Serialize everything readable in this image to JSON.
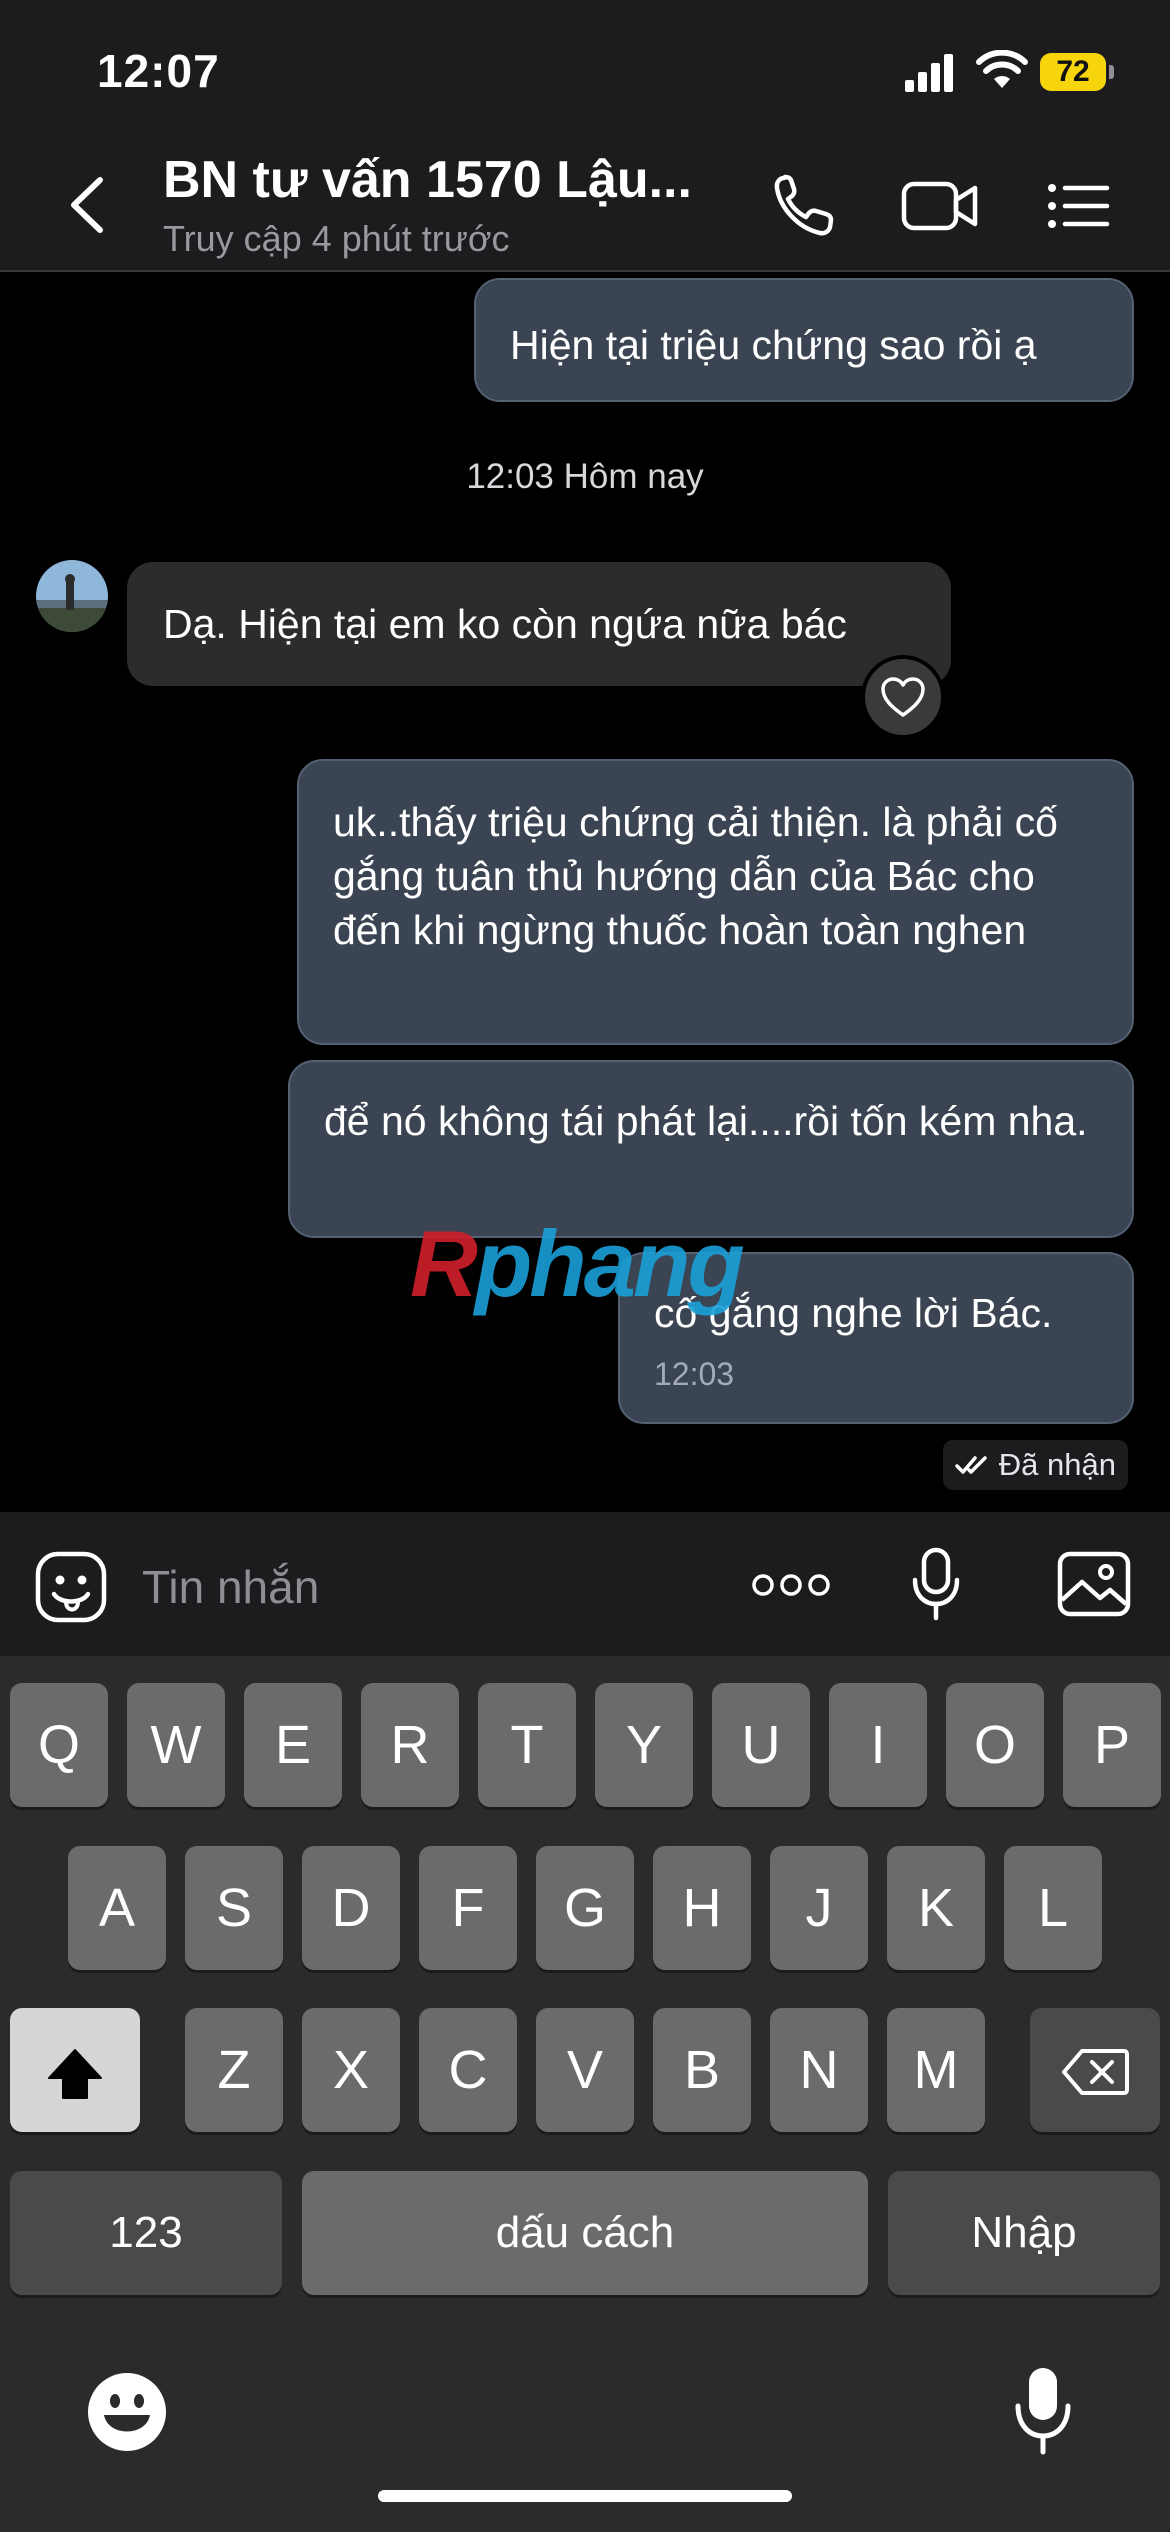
{
  "status_bar": {
    "time": "12:07",
    "battery": "72"
  },
  "header": {
    "title": "BN tư vấn 1570 Lậu...",
    "subtitle": "Truy cập 4 phút trước"
  },
  "messages": {
    "m1": "Hiện tại triệu chứng sao rồi ạ",
    "timestamp": "12:03 Hôm nay",
    "m2": "Dạ. Hiện tại em ko còn ngứa nữa bác",
    "m3": "uk..thấy triệu chứng cải thiện. là phải cố gắng tuân thủ hướng dẫn của Bác cho đến khi ngừng thuốc hoàn toàn nghen",
    "m4": "để nó không tái phát lại....rồi tốn kém nha.",
    "m5": "cố gắng nghe lời Bác.",
    "m5_time": "12:03",
    "status": "Đã nhận"
  },
  "watermark": {
    "first": "R",
    "rest": "phang"
  },
  "composer": {
    "placeholder": "Tin nhắn"
  },
  "keyboard": {
    "row1": [
      "Q",
      "W",
      "E",
      "R",
      "T",
      "Y",
      "U",
      "I",
      "O",
      "P"
    ],
    "row2": [
      "A",
      "S",
      "D",
      "F",
      "G",
      "H",
      "J",
      "K",
      "L"
    ],
    "row3": [
      "Z",
      "X",
      "C",
      "V",
      "B",
      "N",
      "M"
    ],
    "numbers": "123",
    "space": "dấu cách",
    "return": "Nhập"
  },
  "colors": {
    "outgoing_bubble": "#3a4452",
    "incoming_bubble": "#2c2c2e",
    "battery": "#f6d50c"
  },
  "icons": [
    "back-chevron",
    "phone",
    "video-camera",
    "menu-list",
    "heart",
    "emoji-sticker",
    "more-dots",
    "microphone",
    "image",
    "shift-arrow",
    "backspace",
    "emoji-face"
  ]
}
